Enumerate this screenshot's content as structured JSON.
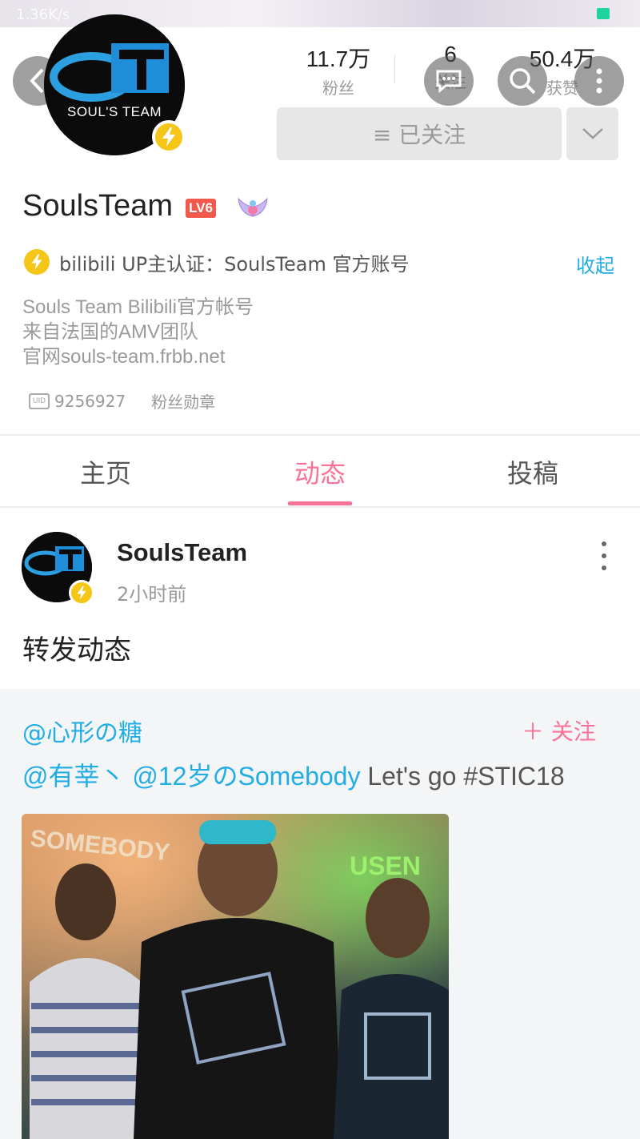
{
  "status_bar": {
    "network_speed": "1.36K/s"
  },
  "header": {
    "avatar_logo_text": "ST",
    "avatar_logo_sub": "SOUL'S TEAM",
    "stats": [
      {
        "value": "11.7万",
        "label": "粉丝"
      },
      {
        "value": "6",
        "label": "关注"
      },
      {
        "value": "50.4万",
        "label": "获赞"
      }
    ],
    "follow_button_label": "≡ 已关注"
  },
  "profile": {
    "username": "SoulsTeam",
    "level_badge": "LV6",
    "verification_text": "bilibili UP主认证：SoulsTeam 官方账号",
    "collapse_label": "收起",
    "bio_lines": [
      "Souls Team Bilibili官方帐号",
      "来自法国的AMV团队",
      "官网souls-team.frbb.net"
    ],
    "uid_icon_text": "UID",
    "uid": "9256927",
    "fan_medal_label": "粉丝勋章"
  },
  "tabs": [
    {
      "label": "主页",
      "active": false
    },
    {
      "label": "动态",
      "active": true
    },
    {
      "label": "投稿",
      "active": false
    }
  ],
  "post": {
    "author": "SoulsTeam",
    "time": "2小时前",
    "text": "转发动态",
    "repost": {
      "original_user": "@心形の糖",
      "follow_label": "＋ 关注",
      "mention_1": "@有莘丶",
      "mention_2": "@12岁のSomebody",
      "body_text": "Let's go #STIC18",
      "photo_sign_text_1": "SOMEBODY",
      "photo_sign_text_2": "USEN"
    }
  },
  "colors": {
    "accent_pink": "#fb7299",
    "link_blue": "#23ade5",
    "verify_yellow": "#f5c518",
    "level_red": "#f0594b"
  }
}
